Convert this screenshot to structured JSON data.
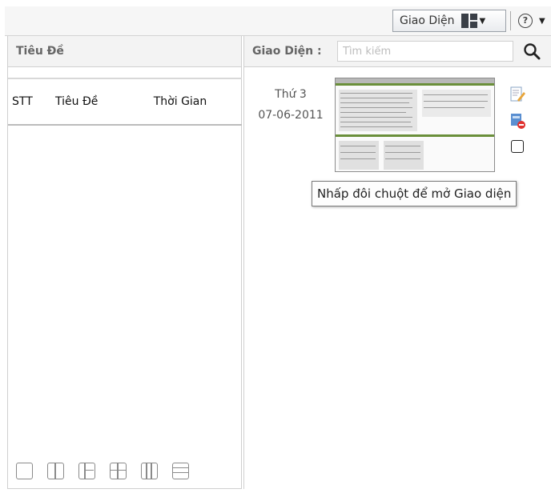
{
  "toolbar": {
    "layout_label": "Giao Diện",
    "layout_icon": "layout-grid-icon",
    "help_icon": "help-icon"
  },
  "left_panel": {
    "title": "Tiêu Đề",
    "columns": [
      "STT",
      "Tiêu Đề",
      "Thời Gian"
    ],
    "layout_options": [
      "single-layout-icon",
      "two-column-layout-icon",
      "sidebar-split-layout-icon",
      "four-grid-layout-icon",
      "three-column-layout-icon",
      "rows-layout-icon"
    ]
  },
  "right_panel": {
    "label": "Giao Diện :",
    "search_placeholder": "Tìm kiếm",
    "item": {
      "day": "Thứ 3",
      "date": "07-06-2011"
    },
    "tooltip": "Nhấp đôi chuột để mở Giao diện"
  }
}
